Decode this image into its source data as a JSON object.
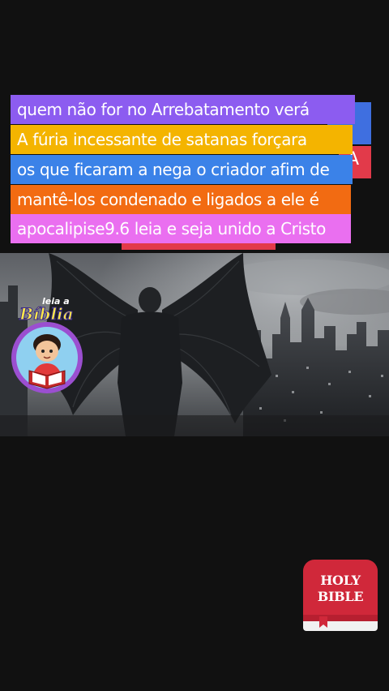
{
  "captions": [
    "quem não for no  Arrebatamento verá",
    "A fúria incessante de satanas forçara",
    "os que ficaram a nega o criador afim de",
    "mantê-los condenado e ligados a ele é",
    "apocalipise9.6 leia e  seja unido a Cristo"
  ],
  "caption_colors": [
    "#8c5cf0",
    "#f4b400",
    "#3b82e8",
    "#f26b12",
    "#ea6ff0"
  ],
  "behind_fragment": "A",
  "logo": {
    "small_text": "leia a",
    "big_text": "Bíblia"
  },
  "app_icon": {
    "line1": "HOLY",
    "line2": "BIBLE",
    "color": "#d0283a"
  }
}
